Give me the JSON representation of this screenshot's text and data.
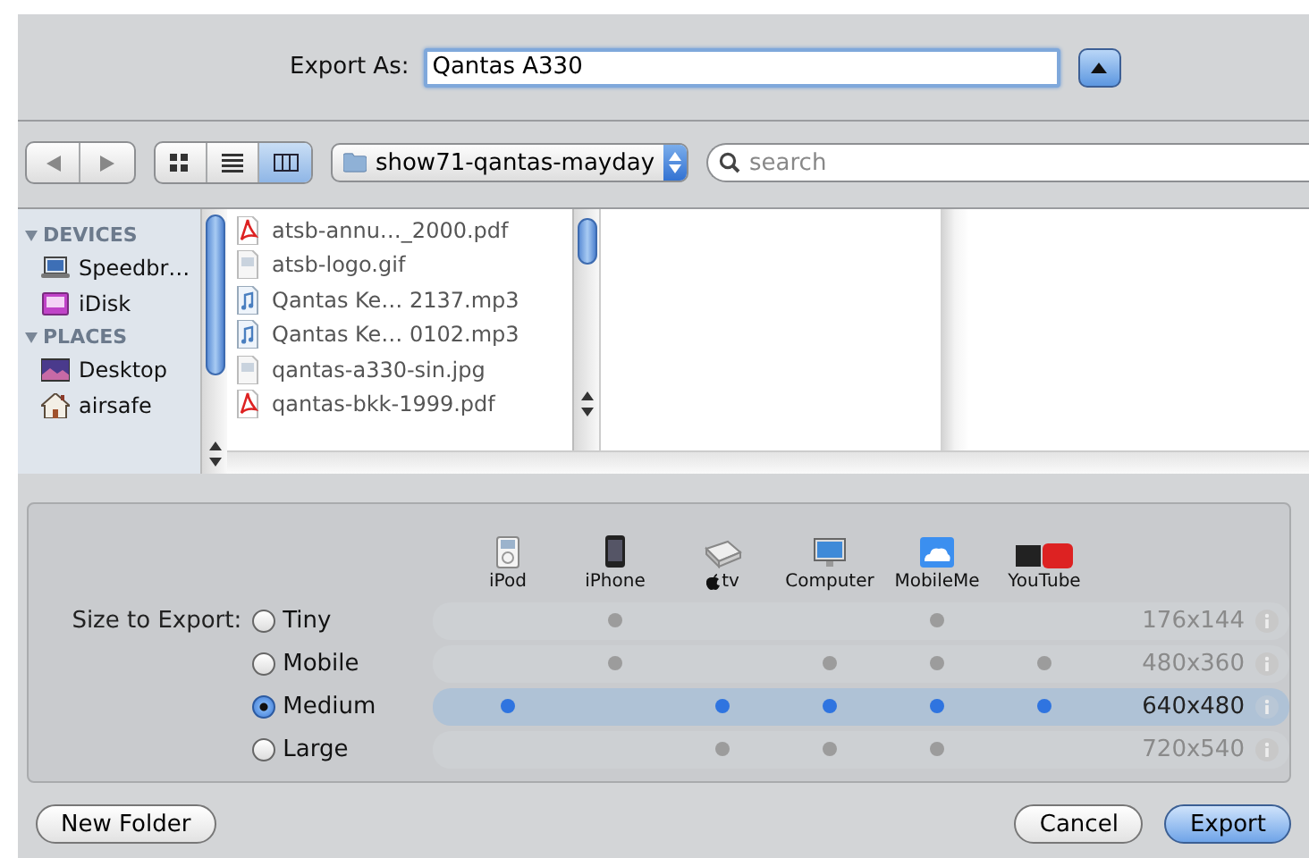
{
  "export_as": {
    "label": "Export As:",
    "value": "Qantas A330"
  },
  "toolbar": {
    "view_modes": [
      {
        "kind": "icons",
        "selected": false
      },
      {
        "kind": "list",
        "selected": false
      },
      {
        "kind": "columns",
        "selected": true
      }
    ],
    "folder": "show71-qantas-mayday",
    "search": {
      "placeholder": "search"
    }
  },
  "sidebar": {
    "sections": [
      {
        "title": "DEVICES",
        "expanded": true,
        "items": [
          {
            "label": "Speedbr…",
            "kind": "laptop"
          },
          {
            "label": "iDisk",
            "kind": "idisk"
          }
        ]
      },
      {
        "title": "PLACES",
        "expanded": true,
        "items": [
          {
            "label": "Desktop",
            "kind": "desktop"
          },
          {
            "label": "airsafe",
            "kind": "home"
          }
        ]
      }
    ]
  },
  "files": [
    {
      "name": "atsb-annu…_2000.pdf",
      "kind": "pdf"
    },
    {
      "name": "atsb-logo.gif",
      "kind": "image"
    },
    {
      "name": "Qantas Ke… 2137.mp3",
      "kind": "audio"
    },
    {
      "name": "Qantas Ke… 0102.mp3",
      "kind": "audio"
    },
    {
      "name": "qantas-a330-sin.jpg",
      "kind": "image"
    },
    {
      "name": "qantas-bkk-1999.pdf",
      "kind": "pdf"
    }
  ],
  "size_panel": {
    "label": "Size to Export:",
    "devices": [
      {
        "name": "iPod",
        "kind": "ipod"
      },
      {
        "name": "iPhone",
        "kind": "iphone"
      },
      {
        "name": "tv",
        "kind": "appletv"
      },
      {
        "name": "Computer",
        "kind": "computer"
      },
      {
        "name": "MobileMe",
        "kind": "mobileme"
      },
      {
        "name": "YouTube",
        "kind": "youtube"
      }
    ],
    "sizes": [
      {
        "name": "Tiny",
        "selected": false,
        "resolution": "176x144",
        "compatible": [
          false,
          true,
          false,
          false,
          true,
          false
        ]
      },
      {
        "name": "Mobile",
        "selected": false,
        "resolution": "480x360",
        "compatible": [
          false,
          true,
          false,
          true,
          true,
          true
        ]
      },
      {
        "name": "Medium",
        "selected": true,
        "resolution": "640x480",
        "compatible": [
          true,
          false,
          true,
          true,
          true,
          true
        ]
      },
      {
        "name": "Large",
        "selected": false,
        "resolution": "720x540",
        "compatible": [
          false,
          false,
          true,
          true,
          true,
          false
        ]
      }
    ]
  },
  "buttons": [
    {
      "label": "New Folder",
      "kind": "secondary"
    },
    {
      "label": "Cancel",
      "kind": "secondary"
    },
    {
      "label": "Export",
      "kind": "default"
    }
  ]
}
